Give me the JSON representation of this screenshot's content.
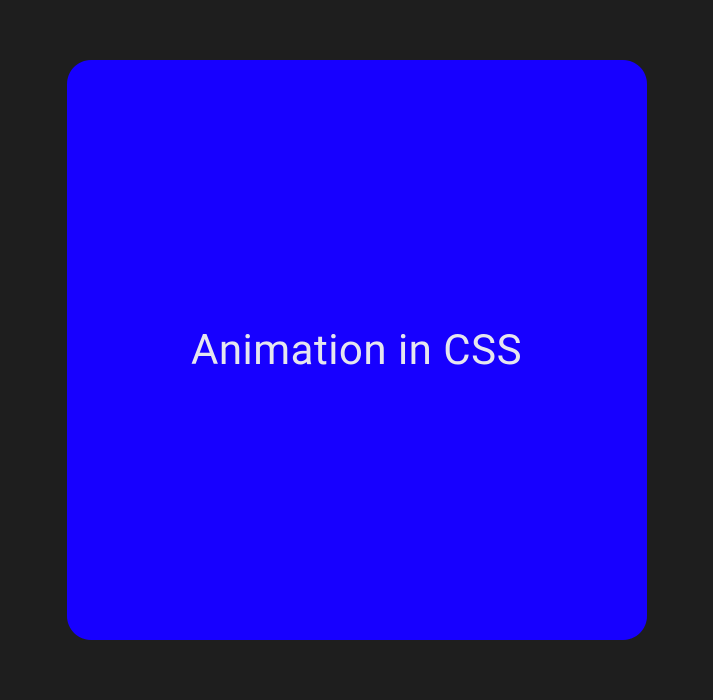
{
  "card": {
    "text": "Animation in CSS",
    "background_color": "#1700ff",
    "text_color": "#e6e6ef"
  },
  "page": {
    "background_color": "#1e1e1e"
  }
}
